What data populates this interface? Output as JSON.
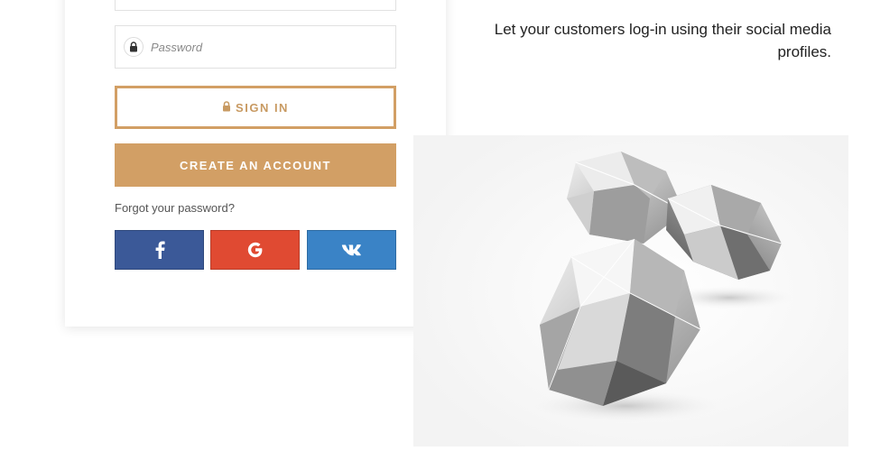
{
  "form": {
    "password_placeholder": "Password",
    "signin_label": "SIGN IN",
    "create_account_label": "CREATE AN ACCOUNT",
    "forgot_password_label": "Forgot your password?"
  },
  "social": {
    "facebook_glyph": "f",
    "google_glyph": "G",
    "vk_glyph": "vk",
    "colors": {
      "facebook": "#3b5998",
      "google": "#e04a32",
      "vk": "#3a83c6"
    }
  },
  "caption": {
    "text": "Let your customers log-in using their social media profiles."
  },
  "theme": {
    "accent": "#d29f65"
  },
  "icons": {
    "password_field": "lock-icon",
    "signin_button": "lock-icon"
  }
}
